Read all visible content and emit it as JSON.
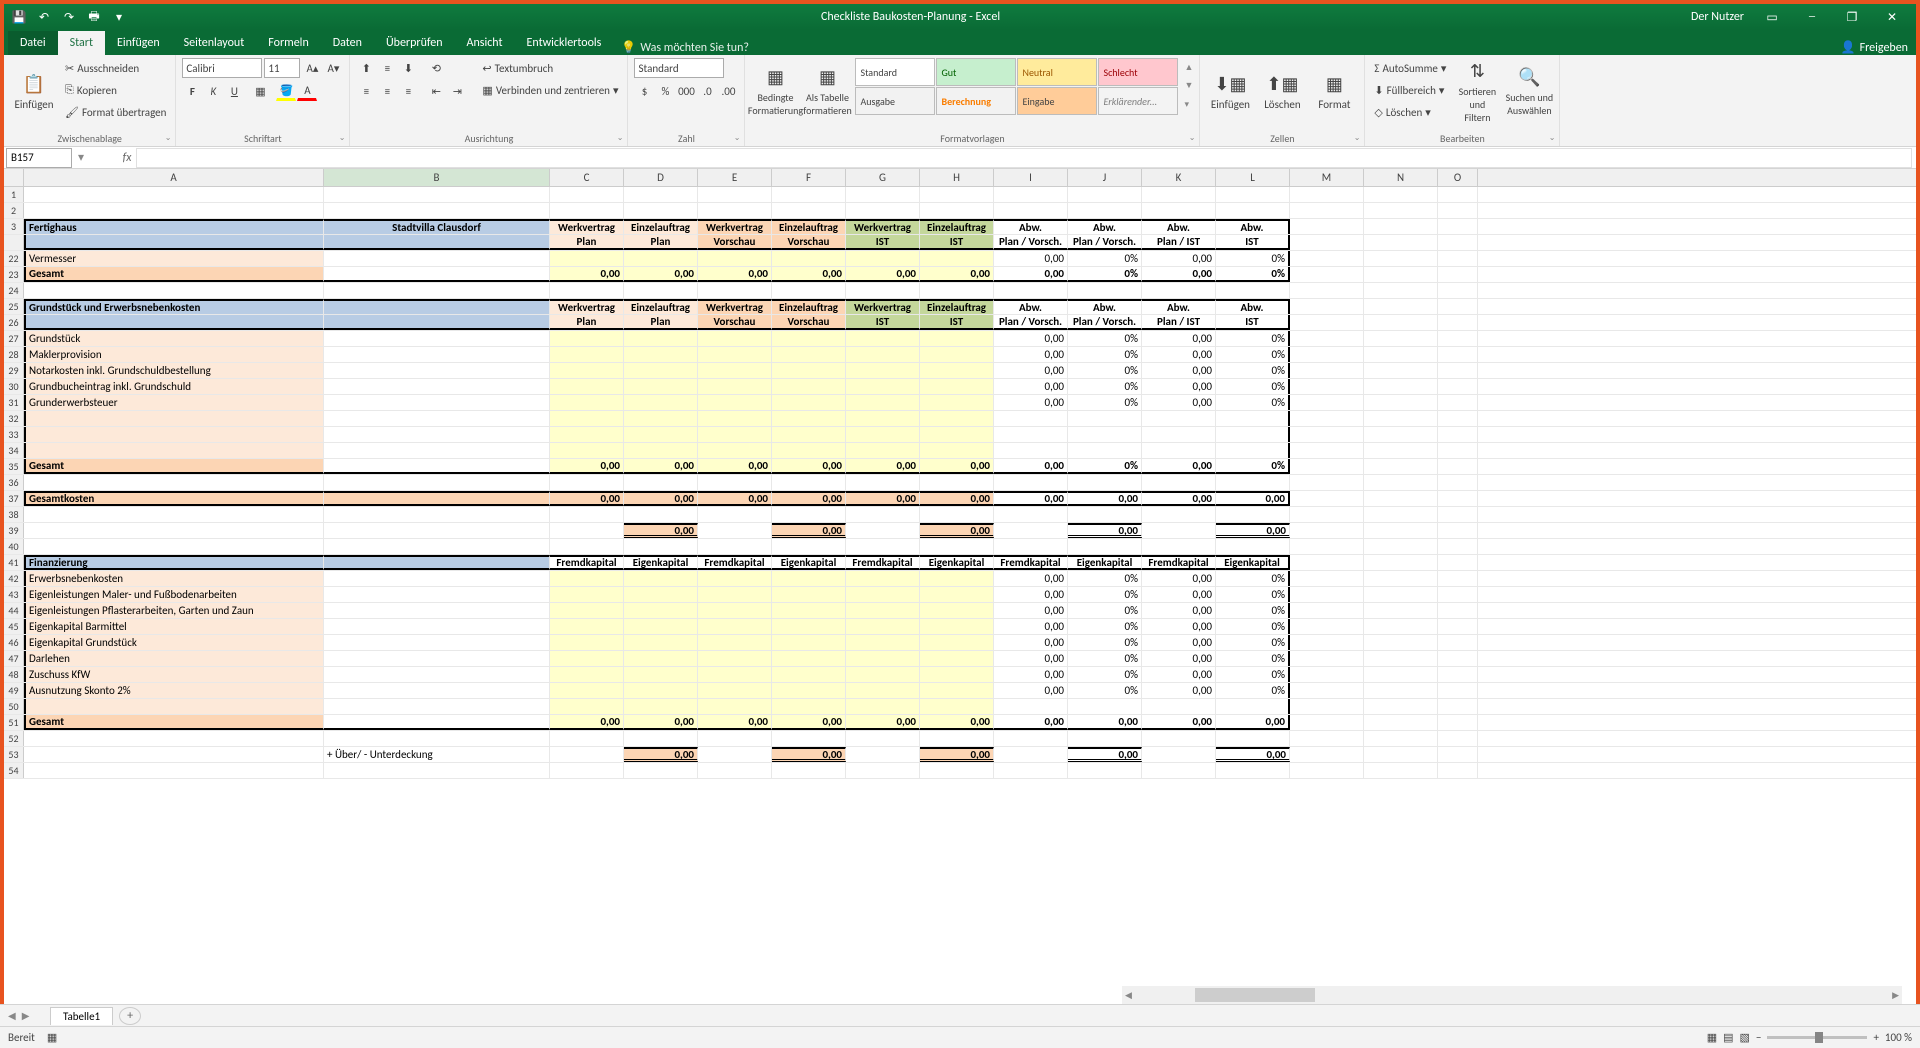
{
  "title": "Checkliste Baukosten-Planung - Excel",
  "user": "Der Nutzer",
  "qat": {
    "save": "💾",
    "undo": "↶",
    "redo": "↷",
    "print": "🖶"
  },
  "tabs": {
    "file": "Datei",
    "home": "Start",
    "insert": "Einfügen",
    "layout": "Seitenlayout",
    "formulas": "Formeln",
    "data": "Daten",
    "review": "Überprüfen",
    "view": "Ansicht",
    "dev": "Entwicklertools",
    "tellme": "Was möchten Sie tun?",
    "share": "Freigeben"
  },
  "ribbon": {
    "clipboard": {
      "paste": "Einfügen",
      "cut": "Ausschneiden",
      "copy": "Kopieren",
      "format": "Format übertragen",
      "label": "Zwischenablage"
    },
    "font": {
      "name": "Calibri",
      "size": "11",
      "label": "Schriftart"
    },
    "align": {
      "wrap": "Textumbruch",
      "merge": "Verbinden und zentrieren",
      "label": "Ausrichtung"
    },
    "number": {
      "format": "Standard",
      "label": "Zahl"
    },
    "styles": {
      "cond": "Bedingte\nFormatierung",
      "table": "Als Tabelle\nformatieren",
      "std": "Standard",
      "gut": "Gut",
      "neu": "Neutral",
      "bad": "Schlecht",
      "aus": "Ausgabe",
      "ber": "Berechnung",
      "ein": "Eingabe",
      "erl": "Erklärender...",
      "label": "Formatvorlagen"
    },
    "cells": {
      "ins": "Einfügen",
      "del": "Löschen",
      "fmt": "Format",
      "label": "Zellen"
    },
    "edit": {
      "sum": "AutoSumme",
      "fill": "Füllbereich",
      "clear": "Löschen",
      "sort": "Sortieren und\nFiltern",
      "find": "Suchen und\nAuswählen",
      "label": "Bearbeiten"
    }
  },
  "namebox": "B157",
  "cols": {
    "rowhead": 20,
    "A": 300,
    "B": 226,
    "C": 74,
    "D": 74,
    "E": 74,
    "F": 74,
    "G": 74,
    "H": 74,
    "I": 74,
    "J": 74,
    "K": 74,
    "L": 74,
    "M": 74,
    "N": 74,
    "O": 40
  },
  "col_letters": [
    "A",
    "B",
    "C",
    "D",
    "E",
    "F",
    "G",
    "H",
    "I",
    "J",
    "K",
    "L",
    "M",
    "N",
    "O"
  ],
  "sheet": {
    "r1": {
      "n": "1"
    },
    "r2": {
      "n": "2"
    },
    "r3": {
      "n": "3",
      "A": "Fertighaus",
      "B": "Stadtvilla Clausdorf",
      "C": "Werkvertrag",
      "D": "Einzelauftrag",
      "E": "Werkvertrag",
      "F": "Einzelauftrag",
      "G": "Werkvertrag",
      "H": "Einzelauftrag",
      "I": "Abw.",
      "J": "Abw.",
      "K": "Abw.",
      "L": "Abw."
    },
    "r4": {
      "n": "",
      "C": "Plan",
      "D": "Plan",
      "E": "Vorschau",
      "F": "Vorschau",
      "G": "IST",
      "H": "IST",
      "I": "Plan / Vorsch.",
      "J": "Plan / Vorsch.",
      "K": "Plan / IST",
      "L": "IST"
    },
    "r22": {
      "n": "22",
      "A": "Vermesser",
      "I": "0,00",
      "J": "0%",
      "K": "0,00",
      "L": "0%"
    },
    "r23": {
      "n": "23",
      "A": "Gesamt",
      "C": "0,00",
      "D": "0,00",
      "E": "0,00",
      "F": "0,00",
      "G": "0,00",
      "H": "0,00",
      "I": "0,00",
      "J": "0%",
      "K": "0,00",
      "L": "0%"
    },
    "r24": {
      "n": "24"
    },
    "r25": {
      "n": "25",
      "A": "Grundstück und Erwerbsnebenkosten",
      "C": "Werkvertrag",
      "D": "Einzelauftrag",
      "E": "Werkvertrag",
      "F": "Einzelauftrag",
      "G": "Werkvertrag",
      "H": "Einzelauftrag",
      "I": "Abw.",
      "J": "Abw.",
      "K": "Abw.",
      "L": "Abw."
    },
    "r26": {
      "n": "26",
      "C": "Plan",
      "D": "Plan",
      "E": "Vorschau",
      "F": "Vorschau",
      "G": "IST",
      "H": "IST",
      "I": "Plan / Vorsch.",
      "J": "Plan / Vorsch.",
      "K": "Plan / IST",
      "L": "IST"
    },
    "r27": {
      "n": "27",
      "A": "Grundstück",
      "I": "0,00",
      "J": "0%",
      "K": "0,00",
      "L": "0%"
    },
    "r28": {
      "n": "28",
      "A": "Maklerprovision",
      "I": "0,00",
      "J": "0%",
      "K": "0,00",
      "L": "0%"
    },
    "r29": {
      "n": "29",
      "A": "Notarkosten inkl. Grundschuldbestellung",
      "I": "0,00",
      "J": "0%",
      "K": "0,00",
      "L": "0%"
    },
    "r30": {
      "n": "30",
      "A": "Grundbucheintrag inkl. Grundschuld",
      "I": "0,00",
      "J": "0%",
      "K": "0,00",
      "L": "0%"
    },
    "r31": {
      "n": "31",
      "A": "Grunderwerbsteuer",
      "I": "0,00",
      "J": "0%",
      "K": "0,00",
      "L": "0%"
    },
    "r32": {
      "n": "32"
    },
    "r33": {
      "n": "33"
    },
    "r34": {
      "n": "34"
    },
    "r35": {
      "n": "35",
      "A": "Gesamt",
      "C": "0,00",
      "D": "0,00",
      "E": "0,00",
      "F": "0,00",
      "G": "0,00",
      "H": "0,00",
      "I": "0,00",
      "J": "0%",
      "K": "0,00",
      "L": "0%"
    },
    "r36": {
      "n": "36"
    },
    "r37": {
      "n": "37",
      "A": "Gesamtkosten",
      "C": "0,00",
      "D": "0,00",
      "E": "0,00",
      "F": "0,00",
      "G": "0,00",
      "H": "0,00",
      "I": "0,00",
      "J": "0,00",
      "K": "0,00",
      "L": "0,00"
    },
    "r38": {
      "n": "38"
    },
    "r39": {
      "n": "39",
      "D": "0,00",
      "F": "0,00",
      "H": "0,00",
      "J": "0,00",
      "L": "0,00"
    },
    "r40": {
      "n": "40"
    },
    "r41": {
      "n": "41",
      "A": "Finanzierung",
      "C": "Fremdkapital",
      "D": "Eigenkapital",
      "E": "Fremdkapital",
      "F": "Eigenkapital",
      "G": "Fremdkapital",
      "H": "Eigenkapital",
      "I": "Fremdkapital",
      "J": "Eigenkapital",
      "K": "Fremdkapital",
      "L": "Eigenkapital"
    },
    "r42": {
      "n": "42",
      "A": "Erwerbsnebenkosten",
      "I": "0,00",
      "J": "0%",
      "K": "0,00",
      "L": "0%"
    },
    "r43": {
      "n": "43",
      "A": "Eigenleistungen Maler- und Fußbodenarbeiten",
      "I": "0,00",
      "J": "0%",
      "K": "0,00",
      "L": "0%"
    },
    "r44": {
      "n": "44",
      "A": "Eigenleistungen Pflasterarbeiten, Garten und Zaun",
      "I": "0,00",
      "J": "0%",
      "K": "0,00",
      "L": "0%"
    },
    "r45": {
      "n": "45",
      "A": "Eigenkapital Barmittel",
      "I": "0,00",
      "J": "0%",
      "K": "0,00",
      "L": "0%"
    },
    "r46": {
      "n": "46",
      "A": "Eigenkapital Grundstück",
      "I": "0,00",
      "J": "0%",
      "K": "0,00",
      "L": "0%"
    },
    "r47": {
      "n": "47",
      "A": "Darlehen",
      "I": "0,00",
      "J": "0%",
      "K": "0,00",
      "L": "0%"
    },
    "r48": {
      "n": "48",
      "A": "Zuschuss KfW",
      "I": "0,00",
      "J": "0%",
      "K": "0,00",
      "L": "0%"
    },
    "r49": {
      "n": "49",
      "A": "Ausnutzung Skonto 2%",
      "I": "0,00",
      "J": "0%",
      "K": "0,00",
      "L": "0%"
    },
    "r50": {
      "n": "50"
    },
    "r51": {
      "n": "51",
      "A": "Gesamt",
      "C": "0,00",
      "D": "0,00",
      "E": "0,00",
      "F": "0,00",
      "G": "0,00",
      "H": "0,00",
      "I": "0,00",
      "J": "0,00",
      "K": "0,00",
      "L": "0,00"
    },
    "r52": {
      "n": "52"
    },
    "r53": {
      "n": "53",
      "B": "+ Über/ - Unterdeckung",
      "D": "0,00",
      "F": "0,00",
      "H": "0,00",
      "J": "0,00",
      "L": "0,00"
    },
    "r54": {
      "n": "54"
    }
  },
  "sheettab": "Tabelle1",
  "status": "Bereit",
  "zoom": "100 %"
}
